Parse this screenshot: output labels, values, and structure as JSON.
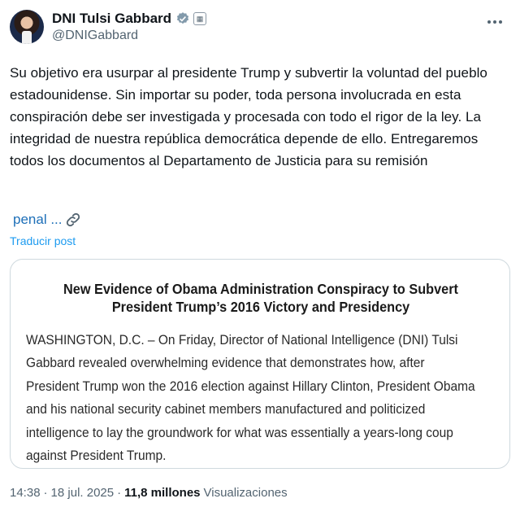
{
  "author": {
    "name": "DNI Tulsi Gabbard",
    "handle": "@DNIGabbard",
    "verified_color": "#829aab",
    "gov_badge_glyph": "▦"
  },
  "post": {
    "text": "Su objetivo era usurpar al presidente Trump y subvertir la voluntad del pueblo estadounidense. Sin importar su poder, toda persona involucrada en esta conspiración debe ser investigada y procesada con todo el rigor de la ley. La integridad de nuestra república democrática depende de ello. Entregaremos todos los documentos al Departamento de Justicia para su remisión",
    "link_text": "penal ...",
    "link_icon": "link-icon",
    "translate_label": "Traducir post"
  },
  "card": {
    "title": "New Evidence of Obama Administration Conspiracy to Subvert President Trump’s 2016 Victory and Presidency",
    "body": "WASHINGTON, D.C. – On Friday, Director of National Intelligence (DNI) Tulsi Gabbard revealed overwhelming evidence that demonstrates how, after President Trump won the 2016 election against Hillary Clinton, President Obama and his national security cabinet members manufactured and politicized intelligence to lay the groundwork for what was essentially a years-long coup against President Trump."
  },
  "meta": {
    "time": "14:38",
    "separator": "·",
    "date": "18 jul. 2025",
    "views_count": "11,8 millones",
    "views_label": "Visualizaciones"
  },
  "colors": {
    "link": "#1d6fb8",
    "accent": "#1d9bf0",
    "muted": "#536471",
    "text": "#0f1419"
  }
}
